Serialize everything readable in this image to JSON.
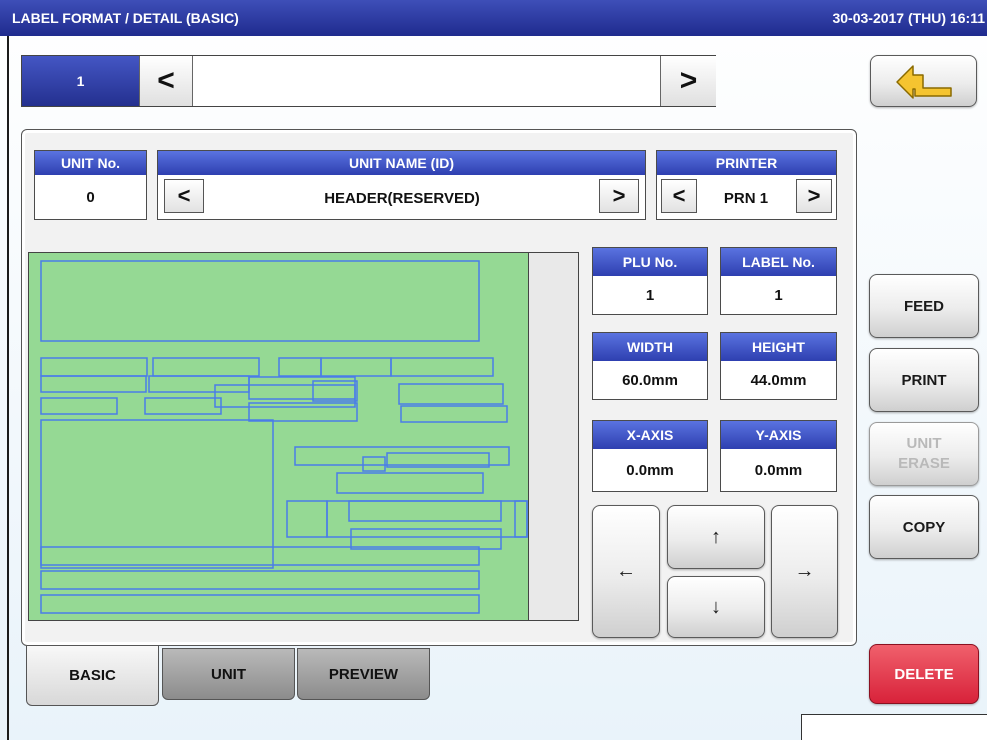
{
  "title": "LABEL FORMAT / DETAIL (BASIC)",
  "datetime": "30-03-2017 (THU) 16:11",
  "selector": {
    "number": "1",
    "prev": "<",
    "next": ">",
    "name": ""
  },
  "back_icon": "return-arrow-icon",
  "unit_no": {
    "label": "UNIT No.",
    "value": "0"
  },
  "unit_name": {
    "label": "UNIT NAME (ID)",
    "value": "HEADER(RESERVED)",
    "prev": "<",
    "next": ">"
  },
  "printer": {
    "label": "PRINTER",
    "value": "PRN 1",
    "prev": "<",
    "next": ">"
  },
  "plu_no": {
    "label": "PLU No.",
    "value": "1"
  },
  "label_no": {
    "label": "LABEL No.",
    "value": "1"
  },
  "width": {
    "label": "WIDTH",
    "value": "60.0mm"
  },
  "height": {
    "label": "HEIGHT",
    "value": "44.0mm"
  },
  "x_axis": {
    "label": "X-AXIS",
    "value": "0.0mm"
  },
  "y_axis": {
    "label": "Y-AXIS",
    "value": "0.0mm"
  },
  "arrows": {
    "left": "←",
    "up": "↑",
    "down": "↓",
    "right": "→"
  },
  "buttons": {
    "feed": "FEED",
    "print": "PRINT",
    "unit_erase_1": "UNIT",
    "unit_erase_2": "ERASE",
    "copy": "COPY",
    "delete": "DELETE"
  },
  "tabs": [
    {
      "label": "BASIC"
    },
    {
      "label": "UNIT"
    },
    {
      "label": "PREVIEW"
    }
  ],
  "colors": {
    "title_bar": "#24308f",
    "header": "#3448c0",
    "label_area": "#95d994",
    "unit_outline": "#4a7de8",
    "delete": "#d8223a"
  }
}
